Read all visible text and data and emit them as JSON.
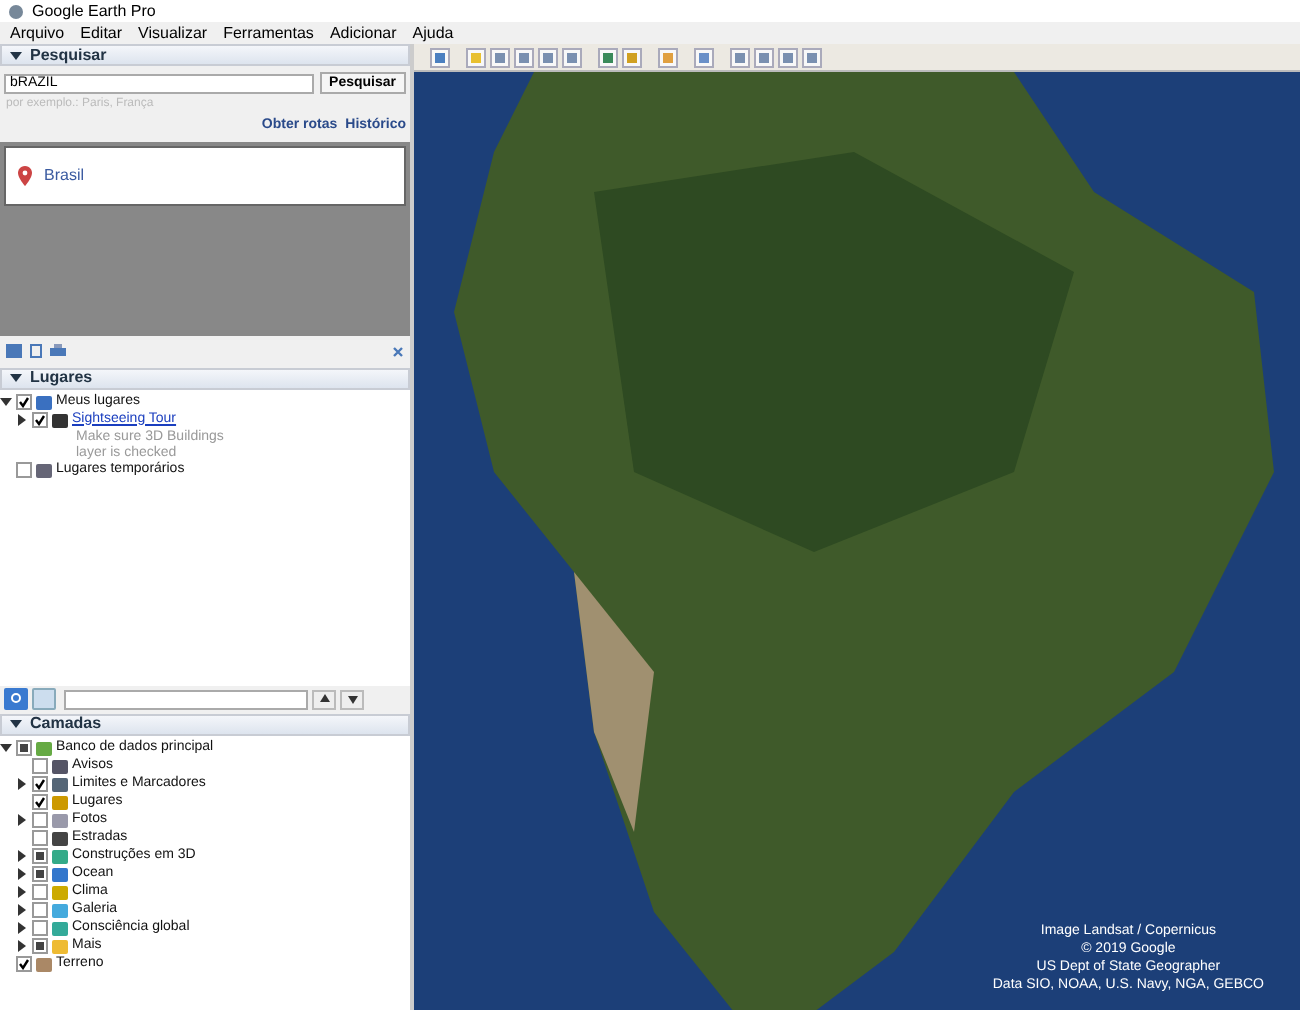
{
  "window": {
    "title": "Google Earth Pro"
  },
  "menu": [
    {
      "label": "Arquivo"
    },
    {
      "label": "Editar"
    },
    {
      "label": "Visualizar"
    },
    {
      "label": "Ferramentas"
    },
    {
      "label": "Adicionar"
    },
    {
      "label": "Ajuda"
    }
  ],
  "search": {
    "title": "Pesquisar",
    "expanded": true,
    "value": "bRAZIL",
    "button": "Pesquisar",
    "hint": "por exemplo.: Paris, França",
    "links": [
      "Obter rotas",
      "Histórico"
    ],
    "results": [
      {
        "label": "Brasil"
      }
    ]
  },
  "places": {
    "title": "Lugares",
    "expanded": true,
    "items": [
      {
        "label": "Meus lugares",
        "checked": true,
        "partial": false,
        "expandable": true,
        "expanded": true,
        "link": false,
        "children": [
          {
            "label": "Sightseeing Tour",
            "checked": true,
            "partial": false,
            "expandable": true,
            "expanded": false,
            "link": true,
            "note": "Make sure 3D Buildings layer is checked"
          }
        ]
      },
      {
        "label": "Lugares temporários",
        "checked": false,
        "partial": false,
        "expandable": false,
        "link": false
      }
    ]
  },
  "layers": {
    "title": "Camadas",
    "expanded": true,
    "items": [
      {
        "label": "Banco de dados principal",
        "checked": false,
        "partial": true,
        "expandable": true,
        "expanded": true,
        "children": [
          {
            "label": "Avisos",
            "checked": false,
            "partial": false,
            "expandable": false
          },
          {
            "label": "Limites e Marcadores",
            "checked": true,
            "partial": false,
            "expandable": true,
            "expanded": false
          },
          {
            "label": "Lugares",
            "checked": true,
            "partial": false,
            "expandable": false
          },
          {
            "label": "Fotos",
            "checked": false,
            "partial": false,
            "expandable": true,
            "expanded": false
          },
          {
            "label": "Estradas",
            "checked": false,
            "partial": false,
            "expandable": false
          },
          {
            "label": "Construções em 3D",
            "checked": false,
            "partial": true,
            "expandable": true,
            "expanded": false
          },
          {
            "label": "Ocean",
            "checked": false,
            "partial": true,
            "expandable": true,
            "expanded": false
          },
          {
            "label": "Clima",
            "checked": false,
            "partial": false,
            "expandable": true,
            "expanded": false
          },
          {
            "label": "Galeria",
            "checked": false,
            "partial": false,
            "expandable": true,
            "expanded": false
          },
          {
            "label": "Consciência global",
            "checked": false,
            "partial": false,
            "expandable": true,
            "expanded": false
          },
          {
            "label": "Mais",
            "checked": false,
            "partial": true,
            "expandable": true,
            "expanded": false
          }
        ]
      },
      {
        "label": "Terreno",
        "checked": true,
        "partial": false,
        "expandable": false
      }
    ]
  },
  "map": {
    "attribution": [
      "Image Landsat / Copernicus",
      "© 2019 Google",
      "US Dept of State Geographer",
      "Data SIO, NOAA, U.S. Navy, NGA, GEBCO"
    ]
  }
}
